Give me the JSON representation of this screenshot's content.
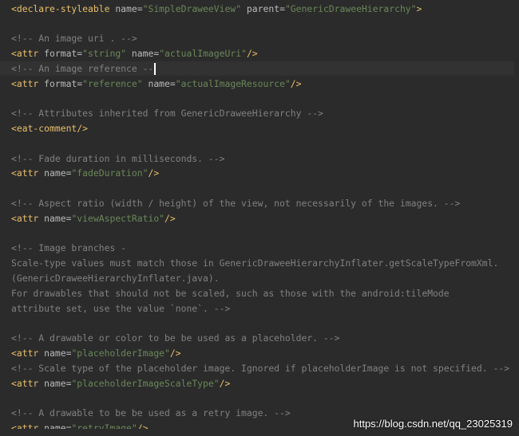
{
  "editor": {
    "lines": [
      {
        "segments": [
          {
            "text": "<declare-styleable ",
            "kind": "tag"
          },
          {
            "text": "name=",
            "kind": "attr"
          },
          {
            "text": "\"SimpleDraweeView\"",
            "kind": "val"
          },
          {
            "text": " parent=",
            "kind": "attr"
          },
          {
            "text": "\"GenericDraweeHierarchy\"",
            "kind": "val"
          },
          {
            "text": ">",
            "kind": "tag"
          }
        ]
      },
      {
        "segments": []
      },
      {
        "segments": [
          {
            "text": "<!-- An image uri . -->",
            "kind": "com"
          }
        ]
      },
      {
        "segments": [
          {
            "text": "<attr ",
            "kind": "tag"
          },
          {
            "text": "format=",
            "kind": "attr"
          },
          {
            "text": "\"string\"",
            "kind": "val"
          },
          {
            "text": " name=",
            "kind": "attr"
          },
          {
            "text": "\"actualImageUri\"",
            "kind": "val"
          },
          {
            "text": "/>",
            "kind": "tag"
          }
        ]
      },
      {
        "segments": [
          {
            "text": "<!-- An image reference --",
            "kind": "com"
          }
        ],
        "highlight": true,
        "caret": true
      },
      {
        "segments": [
          {
            "text": "<attr ",
            "kind": "tag"
          },
          {
            "text": "format=",
            "kind": "attr"
          },
          {
            "text": "\"reference\"",
            "kind": "val"
          },
          {
            "text": " name=",
            "kind": "attr"
          },
          {
            "text": "\"actualImageResource\"",
            "kind": "val"
          },
          {
            "text": "/>",
            "kind": "tag"
          }
        ]
      },
      {
        "segments": []
      },
      {
        "segments": [
          {
            "text": "<!-- Attributes inherited from GenericDraweeHierarchy -->",
            "kind": "com"
          }
        ]
      },
      {
        "segments": [
          {
            "text": "<eat-comment/>",
            "kind": "tag"
          }
        ]
      },
      {
        "segments": []
      },
      {
        "segments": [
          {
            "text": "<!-- Fade duration in milliseconds. -->",
            "kind": "com"
          }
        ]
      },
      {
        "segments": [
          {
            "text": "<attr ",
            "kind": "tag"
          },
          {
            "text": "name=",
            "kind": "attr"
          },
          {
            "text": "\"fadeDuration\"",
            "kind": "val"
          },
          {
            "text": "/>",
            "kind": "tag"
          }
        ]
      },
      {
        "segments": []
      },
      {
        "segments": [
          {
            "text": "<!-- Aspect ratio (width / height) of the view, not necessarily of the images. -->",
            "kind": "com"
          }
        ]
      },
      {
        "segments": [
          {
            "text": "<attr ",
            "kind": "tag"
          },
          {
            "text": "name=",
            "kind": "attr"
          },
          {
            "text": "\"viewAspectRatio\"",
            "kind": "val"
          },
          {
            "text": "/>",
            "kind": "tag"
          }
        ]
      },
      {
        "segments": []
      },
      {
        "segments": [
          {
            "text": "<!-- Image branches -",
            "kind": "com"
          }
        ]
      },
      {
        "segments": [
          {
            "text": "Scale-type values must match those in GenericDraweeHierarchyInflater.getScaleTypeFromXml.",
            "kind": "com"
          }
        ]
      },
      {
        "segments": [
          {
            "text": "(GenericDraweeHierarchyInflater.java).",
            "kind": "com"
          }
        ]
      },
      {
        "segments": [
          {
            "text": "For drawables that should not be scaled, such as those with the android:tileMode",
            "kind": "com"
          }
        ]
      },
      {
        "segments": [
          {
            "text": "attribute set, use the value `none`. -->",
            "kind": "com"
          }
        ]
      },
      {
        "segments": []
      },
      {
        "segments": [
          {
            "text": "<!-- A drawable or color to be be used as a placeholder. -->",
            "kind": "com"
          }
        ]
      },
      {
        "segments": [
          {
            "text": "<attr ",
            "kind": "tag"
          },
          {
            "text": "name=",
            "kind": "attr"
          },
          {
            "text": "\"placeholderImage\"",
            "kind": "val"
          },
          {
            "text": "/>",
            "kind": "tag"
          }
        ]
      },
      {
        "segments": [
          {
            "text": "<!-- Scale type of the placeholder image. Ignored if placeholderImage is not specified. -->",
            "kind": "com"
          }
        ]
      },
      {
        "segments": [
          {
            "text": "<attr ",
            "kind": "tag"
          },
          {
            "text": "name=",
            "kind": "attr"
          },
          {
            "text": "\"placeholderImageScaleType\"",
            "kind": "val"
          },
          {
            "text": "/>",
            "kind": "tag"
          }
        ]
      },
      {
        "segments": []
      },
      {
        "segments": [
          {
            "text": "<!-- A drawable to be be used as a retry image. -->",
            "kind": "com"
          }
        ]
      },
      {
        "segments": [
          {
            "text": "<attr ",
            "kind": "tag"
          },
          {
            "text": "name=",
            "kind": "attr"
          },
          {
            "text": "\"retryImage\"",
            "kind": "val"
          },
          {
            "text": "/>",
            "kind": "tag"
          }
        ]
      }
    ]
  },
  "watermark": "https://blog.csdn.net/qq_23025319",
  "colors": {
    "background": "#2b2b2b",
    "tag": "#e8bf6a",
    "attribute": "#bababa",
    "value": "#6a8759",
    "comment": "#808080",
    "current_line": "#323232"
  }
}
